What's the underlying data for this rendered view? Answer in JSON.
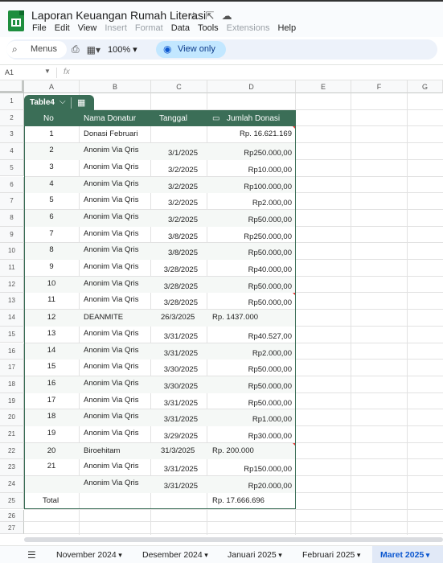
{
  "app": {
    "doc_title": "Laporan Keuangan Rumah Literasi",
    "menu": [
      "File",
      "Edit",
      "View",
      "Insert",
      "Format",
      "Data",
      "Tools",
      "Extensions",
      "Help"
    ],
    "menu_disabled": [
      "Insert",
      "Format",
      "Extensions"
    ]
  },
  "toolbar": {
    "search_label": "Menus",
    "zoom": "100%",
    "view_only_label": "View only"
  },
  "formula_bar": {
    "cell_ref": "A1",
    "fx_label": "fx"
  },
  "columns": [
    "A",
    "B",
    "C",
    "D",
    "E",
    "F",
    "G"
  ],
  "rows": [
    "1",
    "2",
    "3",
    "4",
    "5",
    "6",
    "7",
    "8",
    "9",
    "10",
    "11",
    "12",
    "13",
    "14",
    "15",
    "16",
    "17",
    "18",
    "19",
    "20",
    "21",
    "22",
    "23",
    "24",
    "25",
    "26",
    "27"
  ],
  "table": {
    "name": "Table4",
    "headers": {
      "no": "No",
      "nama": "Nama Donatur",
      "tanggal": "Tanggal",
      "jumlah": "Jumlah Donasi"
    },
    "rows": [
      {
        "no": "1",
        "nama": "Donasi Februari",
        "tanggal": "",
        "jumlah": "Rp. 16.621.169"
      },
      {
        "no": "2",
        "nama": "Anonim Via Qris",
        "tanggal": "3/1/2025",
        "jumlah": "Rp250.000,00"
      },
      {
        "no": "3",
        "nama": "Anonim Via Qris",
        "tanggal": "3/2/2025",
        "jumlah": "Rp10.000,00"
      },
      {
        "no": "4",
        "nama": "Anonim Via Qris",
        "tanggal": "3/2/2025",
        "jumlah": "Rp100.000,00"
      },
      {
        "no": "5",
        "nama": "Anonim Via Qris",
        "tanggal": "3/2/2025",
        "jumlah": "Rp2.000,00"
      },
      {
        "no": "6",
        "nama": "Anonim Via Qris",
        "tanggal": "3/2/2025",
        "jumlah": "Rp50.000,00"
      },
      {
        "no": "7",
        "nama": "Anonim Via Qris",
        "tanggal": "3/8/2025",
        "jumlah": "Rp250.000,00"
      },
      {
        "no": "8",
        "nama": "Anonim Via Qris",
        "tanggal": "3/8/2025",
        "jumlah": "Rp50.000,00"
      },
      {
        "no": "9",
        "nama": "Anonim Via Qris",
        "tanggal": "3/28/2025",
        "jumlah": "Rp40.000,00"
      },
      {
        "no": "10",
        "nama": "Anonim Via Qris",
        "tanggal": "3/28/2025",
        "jumlah": "Rp50.000,00"
      },
      {
        "no": "11",
        "nama": "Anonim Via Qris",
        "tanggal": "3/28/2025",
        "jumlah": "Rp50.000,00"
      },
      {
        "no": "12",
        "nama": "DEANMITE",
        "tanggal": "26/3/2025",
        "jumlah": "Rp. 1437.000"
      },
      {
        "no": "13",
        "nama": "Anonim Via Qris",
        "tanggal": "3/31/2025",
        "jumlah": "Rp40.527,00"
      },
      {
        "no": "14",
        "nama": "Anonim Via Qris",
        "tanggal": "3/31/2025",
        "jumlah": "Rp2.000,00"
      },
      {
        "no": "15",
        "nama": "Anonim Via Qris",
        "tanggal": "3/30/2025",
        "jumlah": "Rp50.000,00"
      },
      {
        "no": "16",
        "nama": "Anonim Via Qris",
        "tanggal": "3/30/2025",
        "jumlah": "Rp50.000,00"
      },
      {
        "no": "17",
        "nama": "Anonim Via Qris",
        "tanggal": "3/31/2025",
        "jumlah": "Rp50.000,00"
      },
      {
        "no": "18",
        "nama": "Anonim Via Qris",
        "tanggal": "3/31/2025",
        "jumlah": "Rp1.000,00"
      },
      {
        "no": "19",
        "nama": "Anonim Via Qris",
        "tanggal": "3/29/2025",
        "jumlah": "Rp30.000,00"
      },
      {
        "no": "20",
        "nama": "Biroehitam",
        "tanggal": "31/3/2025",
        "jumlah": "Rp. 200.000"
      },
      {
        "no": "21",
        "nama": "Anonim Via Qris",
        "tanggal": "3/31/2025",
        "jumlah": "Rp150.000,00"
      },
      {
        "no": "",
        "nama": "Anonim Via Qris",
        "tanggal": "3/31/2025",
        "jumlah": "Rp20.000,00"
      },
      {
        "no": "Total",
        "nama": "",
        "tanggal": "",
        "jumlah": "Rp. 17.666.696"
      }
    ]
  },
  "sheet_tabs": [
    "November 2024",
    "Desember 2024",
    "Januari 2025",
    "Februari 2025",
    "Maret 2025"
  ],
  "active_sheet": "Maret 2025",
  "colors": {
    "table_header": "#3b6e57",
    "active_tab": "#0b57d0",
    "view_only_bg": "#c2e7ff"
  }
}
